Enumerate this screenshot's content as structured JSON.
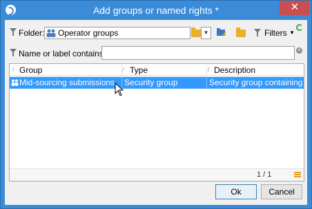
{
  "window": {
    "title": "Add groups or named rights *",
    "close_symbol": "✕"
  },
  "folder_row": {
    "label": "Folder:",
    "value": "Operator groups",
    "dropdown_symbol": "▼",
    "filters_label": "Filters",
    "filters_caret": "▼"
  },
  "search_row": {
    "label": "Name or label contains:",
    "value": "",
    "clear_symbol": "✕"
  },
  "grid": {
    "columns": [
      "Group",
      "Type",
      "Description"
    ],
    "rows": [
      {
        "group": "Mid-sourcing submissions",
        "type": "Security group",
        "description": "Security group containing rig."
      }
    ],
    "pager": "1 / 1"
  },
  "buttons": {
    "ok": "Ok",
    "cancel": "Cancel"
  },
  "colors": {
    "titlebar": "#3b8bd8",
    "close": "#c74f4f",
    "selection": "#3399ff",
    "folder": "#e6b02b"
  }
}
